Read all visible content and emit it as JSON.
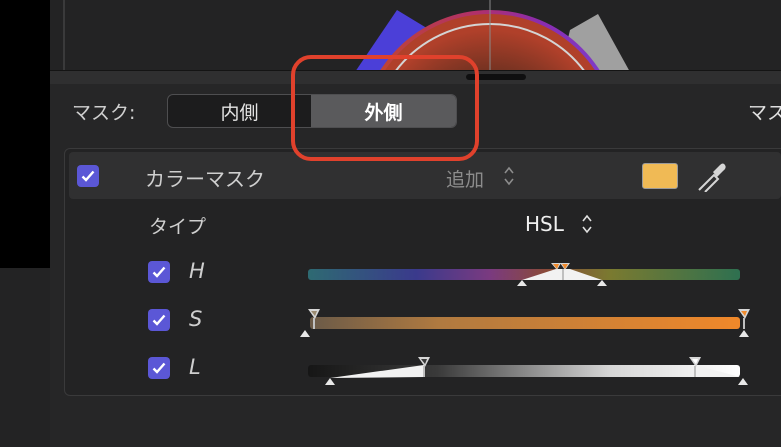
{
  "mask": {
    "label": "マスク:",
    "segments": [
      "内側",
      "外側"
    ],
    "selected": "外側",
    "right_label": "マスク"
  },
  "color_mask": {
    "enabled": true,
    "title": "カラーマスク",
    "mode": "追加",
    "swatch_color": "#f0ba55"
  },
  "type_row": {
    "label": "タイプ",
    "value": "HSL"
  },
  "channels": [
    {
      "label": "H",
      "enabled": true
    },
    {
      "label": "S",
      "enabled": true
    },
    {
      "label": "L",
      "enabled": true
    }
  ],
  "colors": {
    "accent_checkbox": "#5b57d6",
    "highlight": "#e0412c",
    "orange": "#f08a2c"
  }
}
